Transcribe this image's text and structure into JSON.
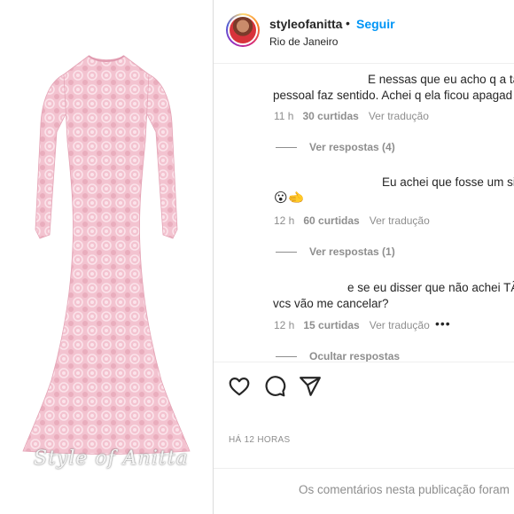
{
  "header": {
    "username": "styleofanitta",
    "separator": "•",
    "follow_label": "Seguir",
    "location": "Rio de Janeiro"
  },
  "photo": {
    "watermark": "Style of Anitta",
    "dress_color": "#f5c6d2"
  },
  "comments": [
    {
      "lines": [
        "E nessas que eu acho q a ta",
        "pessoal faz sentido. Achei q ela ficou apagad"
      ],
      "time": "11 h",
      "likes": "30 curtidas",
      "translate": "Ver tradução",
      "replies": "Ver respostas (4)"
    },
    {
      "lines": [
        "Eu achei que fosse um si"
      ],
      "emoji": "😮🫲",
      "time": "12 h",
      "likes": "60 curtidas",
      "translate": "Ver tradução",
      "replies": "Ver respostas (1)"
    },
    {
      "lines": [
        "e se eu disser que não achei TÃ",
        "vcs vão me cancelar?"
      ],
      "time": "12 h",
      "likes": "15 curtidas",
      "translate": "Ver tradução",
      "more": "•••",
      "replies": "Ocultar respostas"
    }
  ],
  "actions": {
    "like_icon": "heart-icon",
    "comment_icon": "comment-icon",
    "share_icon": "send-icon",
    "posted": "HÁ 12 HORAS"
  },
  "footer": {
    "text": "Os comentários nesta publicação foram"
  },
  "colors": {
    "link": "#0095f6",
    "muted": "#8e8e8e",
    "text": "#262626"
  }
}
